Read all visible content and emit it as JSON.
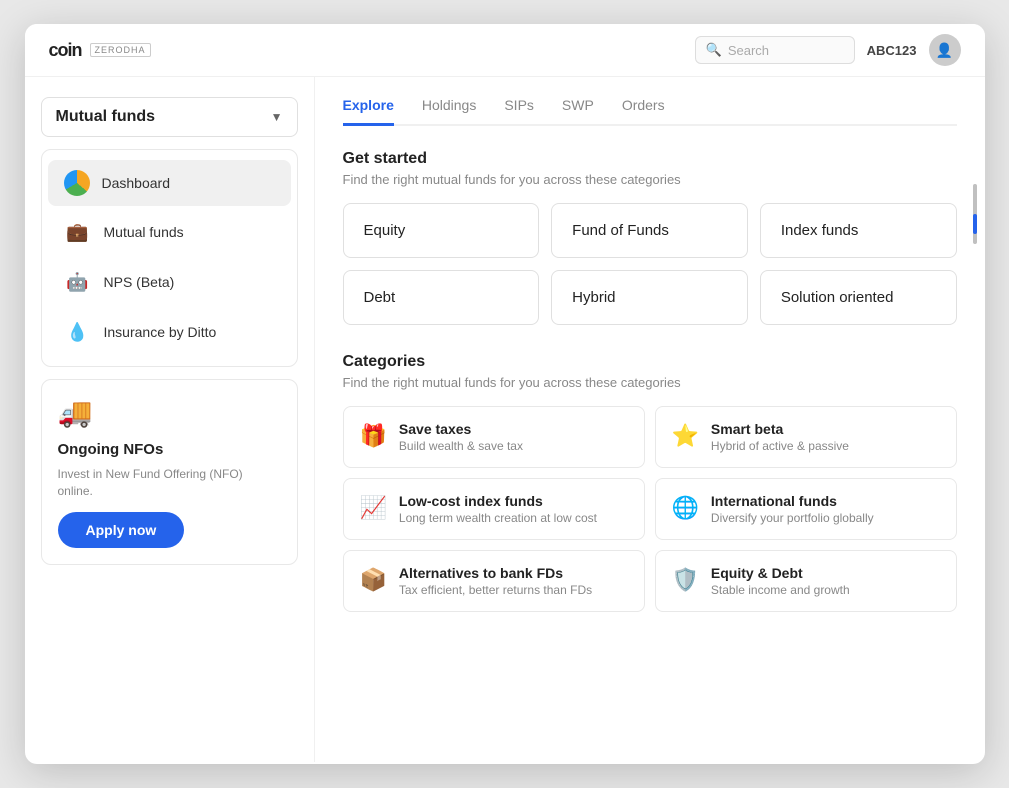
{
  "header": {
    "logo": "coin",
    "brand": "ZERODHA",
    "search_placeholder": "Search",
    "user_id": "ABC123"
  },
  "sidebar": {
    "dropdown_label": "Mutual funds",
    "nav_items": [
      {
        "id": "dashboard",
        "label": "Dashboard",
        "icon": "pie"
      },
      {
        "id": "mutual-funds",
        "label": "Mutual funds",
        "icon": "briefcase"
      },
      {
        "id": "nps",
        "label": "NPS (Beta)",
        "icon": "nps"
      },
      {
        "id": "insurance",
        "label": "Insurance by Ditto",
        "icon": "drop"
      }
    ],
    "nfo": {
      "title": "Ongoing NFOs",
      "description": "Invest in New Fund Offering (NFO) online.",
      "button_label": "Apply now"
    }
  },
  "main": {
    "tabs": [
      {
        "id": "explore",
        "label": "Explore",
        "active": true
      },
      {
        "id": "holdings",
        "label": "Holdings",
        "active": false
      },
      {
        "id": "sips",
        "label": "SIPs",
        "active": false
      },
      {
        "id": "swp",
        "label": "SWP",
        "active": false
      },
      {
        "id": "orders",
        "label": "Orders",
        "active": false
      }
    ],
    "get_started": {
      "title": "Get started",
      "description": "Find the right mutual funds for you across these categories"
    },
    "fund_types": [
      {
        "id": "equity",
        "label": "Equity"
      },
      {
        "id": "fund-of-funds",
        "label": "Fund of Funds"
      },
      {
        "id": "index-funds",
        "label": "Index funds"
      },
      {
        "id": "debt",
        "label": "Debt"
      },
      {
        "id": "hybrid",
        "label": "Hybrid"
      },
      {
        "id": "solution-oriented",
        "label": "Solution oriented"
      }
    ],
    "categories": {
      "title": "Categories",
      "description": "Find the right mutual funds for you across these categories",
      "items": [
        {
          "id": "save-taxes",
          "name": "Save taxes",
          "desc": "Build wealth & save tax",
          "icon": "🎁"
        },
        {
          "id": "smart-beta",
          "name": "Smart beta",
          "desc": "Hybrid of active & passive",
          "icon": "⭐"
        },
        {
          "id": "low-cost-index",
          "name": "Low-cost index funds",
          "desc": "Long term wealth creation at low cost",
          "icon": "📈"
        },
        {
          "id": "international",
          "name": "International funds",
          "desc": "Diversify your portfolio globally",
          "icon": "🌐"
        },
        {
          "id": "alternatives",
          "name": "Alternatives to bank FDs",
          "desc": "Tax efficient, better returns than FDs",
          "icon": "📦"
        },
        {
          "id": "equity-debt",
          "name": "Equity & Debt",
          "desc": "Stable income and growth",
          "icon": "🛡️"
        }
      ]
    }
  }
}
